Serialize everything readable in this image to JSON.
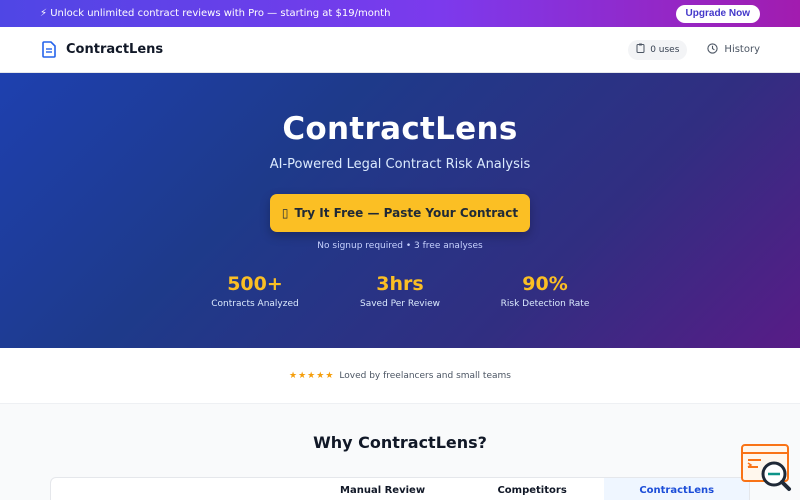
{
  "promo": {
    "text": "⚡ Unlock unlimited contract reviews with Pro — starting at $19/month",
    "button": "Upgrade Now"
  },
  "nav": {
    "brand": "ContractLens",
    "uses": "0 uses",
    "history": "History"
  },
  "hero": {
    "title": "ContractLens",
    "subtitle": "AI-Powered Legal Contract Risk Analysis",
    "cta_icon": "▯",
    "cta": "Try It Free — Paste Your Contract",
    "note": "No signup required • 3 free analyses",
    "stats": [
      {
        "value": "500+",
        "label": "Contracts Analyzed"
      },
      {
        "value": "3hrs",
        "label": "Saved Per Review"
      },
      {
        "value": "90%",
        "label": "Risk Detection Rate"
      }
    ]
  },
  "proof": {
    "stars": "★★★★★",
    "text": "Loved by freelancers and small teams"
  },
  "why": {
    "title": "Why ContractLens?",
    "columns": [
      "Manual Review",
      "Competitors",
      "ContractLens"
    ]
  },
  "colors": {
    "accent": "#fbbf24",
    "brand_blue": "#1e40af",
    "promo_purple": "#7c3aed"
  },
  "icons": {
    "brand": "document-icon",
    "uses": "clipboard-icon",
    "history": "clock-icon",
    "widget": "search-analysis-icon"
  }
}
